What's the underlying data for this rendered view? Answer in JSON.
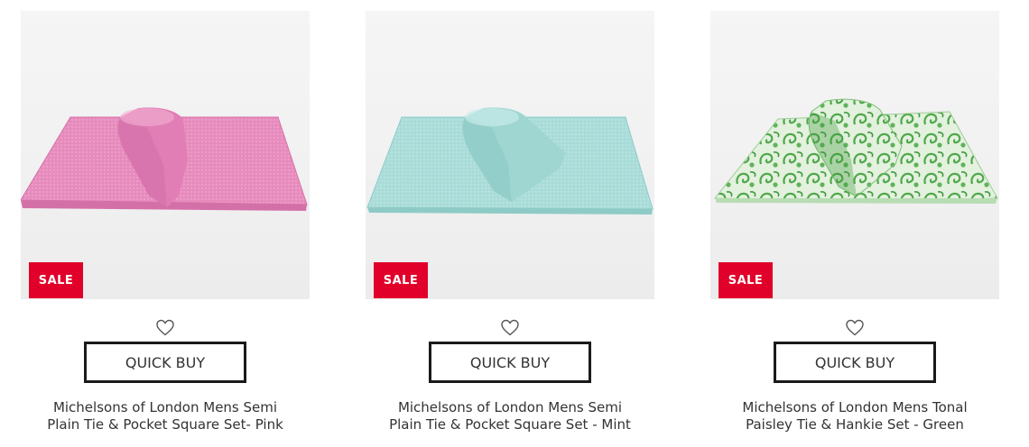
{
  "products": [
    {
      "badge": "SALE",
      "quick_buy_label": "QUICK BUY",
      "title_line1": "Michelsons of London Mens Semi",
      "title_line2": "Plain Tie & Pocket Square Set- Pink",
      "colors": {
        "fabric": "#e78bbd",
        "fabric_shade": "#d470a8",
        "fabric_light": "#f2b0d2"
      }
    },
    {
      "badge": "SALE",
      "quick_buy_label": "QUICK BUY",
      "title_line1": "Michelsons of London Mens Semi",
      "title_line2": "Plain Tie & Pocket Square Set - Mint",
      "colors": {
        "fabric": "#a9dcd8",
        "fabric_shade": "#8ecbc6",
        "fabric_light": "#c8ebe8"
      }
    },
    {
      "badge": "SALE",
      "quick_buy_label": "QUICK BUY",
      "title_line1": "Michelsons of London Mens Tonal",
      "title_line2": "Paisley Tie & Hankie Set - Green",
      "colors": {
        "fabric": "#5fb35a",
        "fabric_shade": "#3f9a3d",
        "fabric_light": "#e3f1de"
      }
    }
  ],
  "accent": {
    "sale_red": "#e0002a",
    "button_border": "#1a1a1a"
  },
  "icons": {
    "wishlist": "heart-outline-icon"
  }
}
